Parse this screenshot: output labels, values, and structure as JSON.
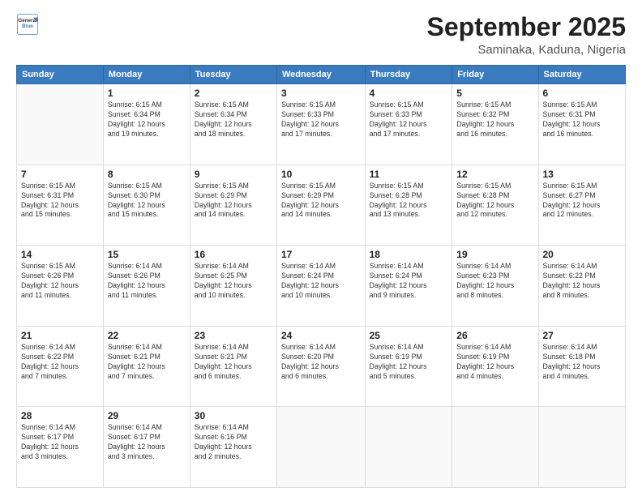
{
  "logo": {
    "line1": "General",
    "line2": "Blue"
  },
  "header": {
    "month": "September 2025",
    "location": "Saminaka, Kaduna, Nigeria"
  },
  "weekdays": [
    "Sunday",
    "Monday",
    "Tuesday",
    "Wednesday",
    "Thursday",
    "Friday",
    "Saturday"
  ],
  "weeks": [
    [
      {
        "day": "",
        "info": ""
      },
      {
        "day": "1",
        "info": "Sunrise: 6:15 AM\nSunset: 6:34 PM\nDaylight: 12 hours\nand 19 minutes."
      },
      {
        "day": "2",
        "info": "Sunrise: 6:15 AM\nSunset: 6:34 PM\nDaylight: 12 hours\nand 18 minutes."
      },
      {
        "day": "3",
        "info": "Sunrise: 6:15 AM\nSunset: 6:33 PM\nDaylight: 12 hours\nand 17 minutes."
      },
      {
        "day": "4",
        "info": "Sunrise: 6:15 AM\nSunset: 6:33 PM\nDaylight: 12 hours\nand 17 minutes."
      },
      {
        "day": "5",
        "info": "Sunrise: 6:15 AM\nSunset: 6:32 PM\nDaylight: 12 hours\nand 16 minutes."
      },
      {
        "day": "6",
        "info": "Sunrise: 6:15 AM\nSunset: 6:31 PM\nDaylight: 12 hours\nand 16 minutes."
      }
    ],
    [
      {
        "day": "7",
        "info": "Sunrise: 6:15 AM\nSunset: 6:31 PM\nDaylight: 12 hours\nand 15 minutes."
      },
      {
        "day": "8",
        "info": "Sunrise: 6:15 AM\nSunset: 6:30 PM\nDaylight: 12 hours\nand 15 minutes."
      },
      {
        "day": "9",
        "info": "Sunrise: 6:15 AM\nSunset: 6:29 PM\nDaylight: 12 hours\nand 14 minutes."
      },
      {
        "day": "10",
        "info": "Sunrise: 6:15 AM\nSunset: 6:29 PM\nDaylight: 12 hours\nand 14 minutes."
      },
      {
        "day": "11",
        "info": "Sunrise: 6:15 AM\nSunset: 6:28 PM\nDaylight: 12 hours\nand 13 minutes."
      },
      {
        "day": "12",
        "info": "Sunrise: 6:15 AM\nSunset: 6:28 PM\nDaylight: 12 hours\nand 12 minutes."
      },
      {
        "day": "13",
        "info": "Sunrise: 6:15 AM\nSunset: 6:27 PM\nDaylight: 12 hours\nand 12 minutes."
      }
    ],
    [
      {
        "day": "14",
        "info": "Sunrise: 6:15 AM\nSunset: 6:26 PM\nDaylight: 12 hours\nand 11 minutes."
      },
      {
        "day": "15",
        "info": "Sunrise: 6:14 AM\nSunset: 6:26 PM\nDaylight: 12 hours\nand 11 minutes."
      },
      {
        "day": "16",
        "info": "Sunrise: 6:14 AM\nSunset: 6:25 PM\nDaylight: 12 hours\nand 10 minutes."
      },
      {
        "day": "17",
        "info": "Sunrise: 6:14 AM\nSunset: 6:24 PM\nDaylight: 12 hours\nand 10 minutes."
      },
      {
        "day": "18",
        "info": "Sunrise: 6:14 AM\nSunset: 6:24 PM\nDaylight: 12 hours\nand 9 minutes."
      },
      {
        "day": "19",
        "info": "Sunrise: 6:14 AM\nSunset: 6:23 PM\nDaylight: 12 hours\nand 8 minutes."
      },
      {
        "day": "20",
        "info": "Sunrise: 6:14 AM\nSunset: 6:22 PM\nDaylight: 12 hours\nand 8 minutes."
      }
    ],
    [
      {
        "day": "21",
        "info": "Sunrise: 6:14 AM\nSunset: 6:22 PM\nDaylight: 12 hours\nand 7 minutes."
      },
      {
        "day": "22",
        "info": "Sunrise: 6:14 AM\nSunset: 6:21 PM\nDaylight: 12 hours\nand 7 minutes."
      },
      {
        "day": "23",
        "info": "Sunrise: 6:14 AM\nSunset: 6:21 PM\nDaylight: 12 hours\nand 6 minutes."
      },
      {
        "day": "24",
        "info": "Sunrise: 6:14 AM\nSunset: 6:20 PM\nDaylight: 12 hours\nand 6 minutes."
      },
      {
        "day": "25",
        "info": "Sunrise: 6:14 AM\nSunset: 6:19 PM\nDaylight: 12 hours\nand 5 minutes."
      },
      {
        "day": "26",
        "info": "Sunrise: 6:14 AM\nSunset: 6:19 PM\nDaylight: 12 hours\nand 4 minutes."
      },
      {
        "day": "27",
        "info": "Sunrise: 6:14 AM\nSunset: 6:18 PM\nDaylight: 12 hours\nand 4 minutes."
      }
    ],
    [
      {
        "day": "28",
        "info": "Sunrise: 6:14 AM\nSunset: 6:17 PM\nDaylight: 12 hours\nand 3 minutes."
      },
      {
        "day": "29",
        "info": "Sunrise: 6:14 AM\nSunset: 6:17 PM\nDaylight: 12 hours\nand 3 minutes."
      },
      {
        "day": "30",
        "info": "Sunrise: 6:14 AM\nSunset: 6:16 PM\nDaylight: 12 hours\nand 2 minutes."
      },
      {
        "day": "",
        "info": ""
      },
      {
        "day": "",
        "info": ""
      },
      {
        "day": "",
        "info": ""
      },
      {
        "day": "",
        "info": ""
      }
    ]
  ]
}
